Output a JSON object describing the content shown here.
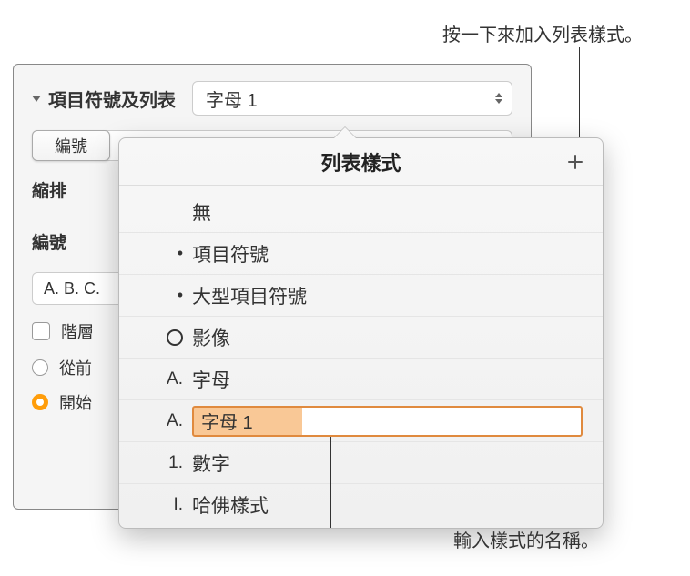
{
  "callouts": {
    "top": "按一下來加入列表樣式。",
    "bottom": "輸入樣式的名稱。"
  },
  "panel": {
    "section_title": "項目符號及列表",
    "dropdown_value": "字母 1",
    "segment_active": "編號",
    "indent_label": "縮排",
    "numbering_label": "編號",
    "format_example": "A. B. C.",
    "check_tier": "階層",
    "radio_continue": "從前",
    "radio_start": "開始"
  },
  "popover": {
    "title": "列表樣式",
    "items": [
      {
        "marker": "",
        "label": "無",
        "type": "none"
      },
      {
        "marker": "•",
        "label": "項目符號",
        "type": "bullet"
      },
      {
        "marker": "•",
        "label": "大型項目符號",
        "type": "bullet"
      },
      {
        "marker": "○",
        "label": "影像",
        "type": "image"
      },
      {
        "marker": "A.",
        "label": "字母",
        "type": "letter"
      },
      {
        "marker": "A.",
        "label": "字母 1",
        "type": "editing"
      },
      {
        "marker": "1.",
        "label": "數字",
        "type": "number"
      },
      {
        "marker": "I.",
        "label": "哈佛樣式",
        "type": "roman"
      }
    ]
  }
}
